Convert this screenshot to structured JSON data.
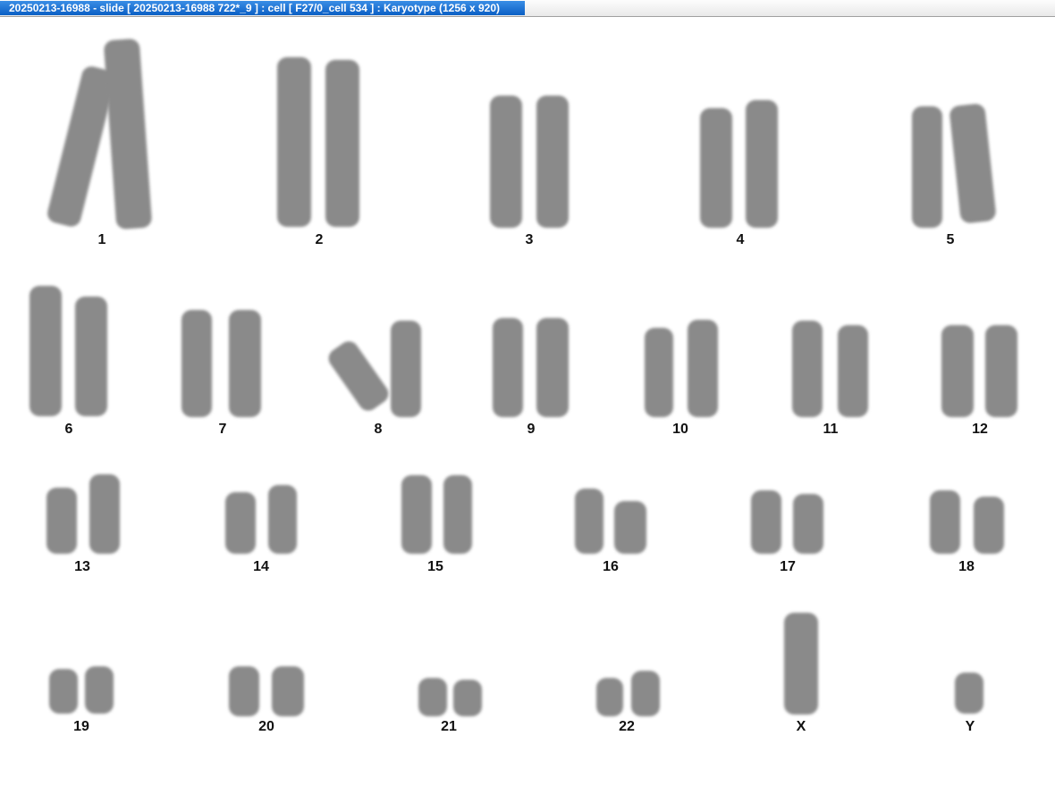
{
  "window": {
    "title": "20250213-16988 - slide [ 20250213-16988 722*_9 ] : cell [ F27/0_cell 534 ] : Karyotype  (1256 x 920)"
  },
  "karyotype": {
    "labels": [
      "1",
      "2",
      "3",
      "4",
      "5",
      "6",
      "7",
      "8",
      "9",
      "10",
      "11",
      "12",
      "13",
      "14",
      "15",
      "16",
      "17",
      "18",
      "19",
      "20",
      "21",
      "22",
      "X",
      "Y"
    ]
  },
  "colors": {
    "title_bar": "#0a5fc4",
    "chromosome": "#8a8a8a",
    "background": "#ffffff"
  }
}
